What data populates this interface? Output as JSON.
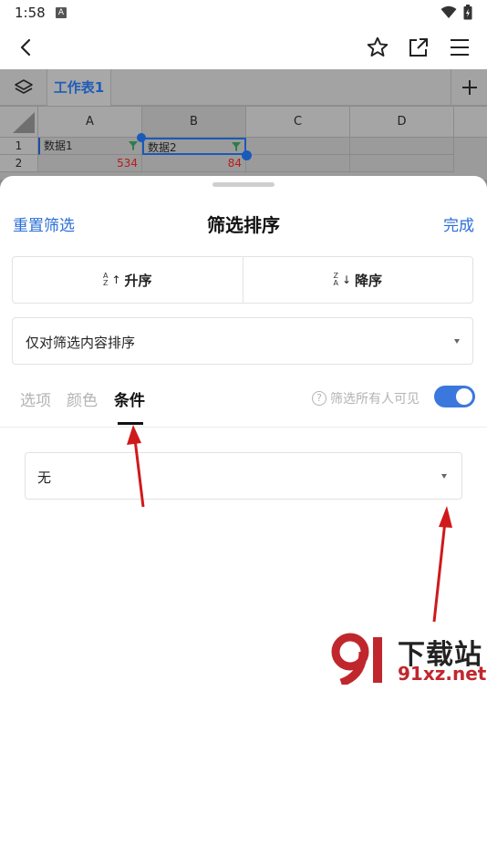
{
  "status_bar": {
    "time": "1:58",
    "notif": "A"
  },
  "app_bar": {
    "back": "back-icon",
    "star": "star-icon",
    "share": "share-icon",
    "menu": "menu-icon"
  },
  "sheet_tabs": {
    "active_sheet": "工作表1"
  },
  "grid": {
    "columns": [
      "A",
      "B",
      "C",
      "D"
    ],
    "rows": [
      "1",
      "2"
    ],
    "cells": {
      "A1": "数据1",
      "B1": "数据2",
      "A2": "534",
      "B2": "84"
    }
  },
  "panel": {
    "reset_label": "重置筛选",
    "title": "筛选排序",
    "done_label": "完成",
    "sort_asc": "升序",
    "sort_desc": "降序",
    "scope_value": "仅对筛选内容排序",
    "tabs": [
      "选项",
      "颜色",
      "条件"
    ],
    "active_tab": "条件",
    "visible_label": "筛选所有人可见",
    "visible_toggle": true,
    "condition_value": "无"
  },
  "watermark": {
    "text": "下载站",
    "sub": "91xz.net"
  },
  "colors": {
    "accent": "#2c6fd6",
    "toggle": "#3b78dd",
    "red_number": "#b81c1c",
    "arrow": "#d0191b"
  }
}
